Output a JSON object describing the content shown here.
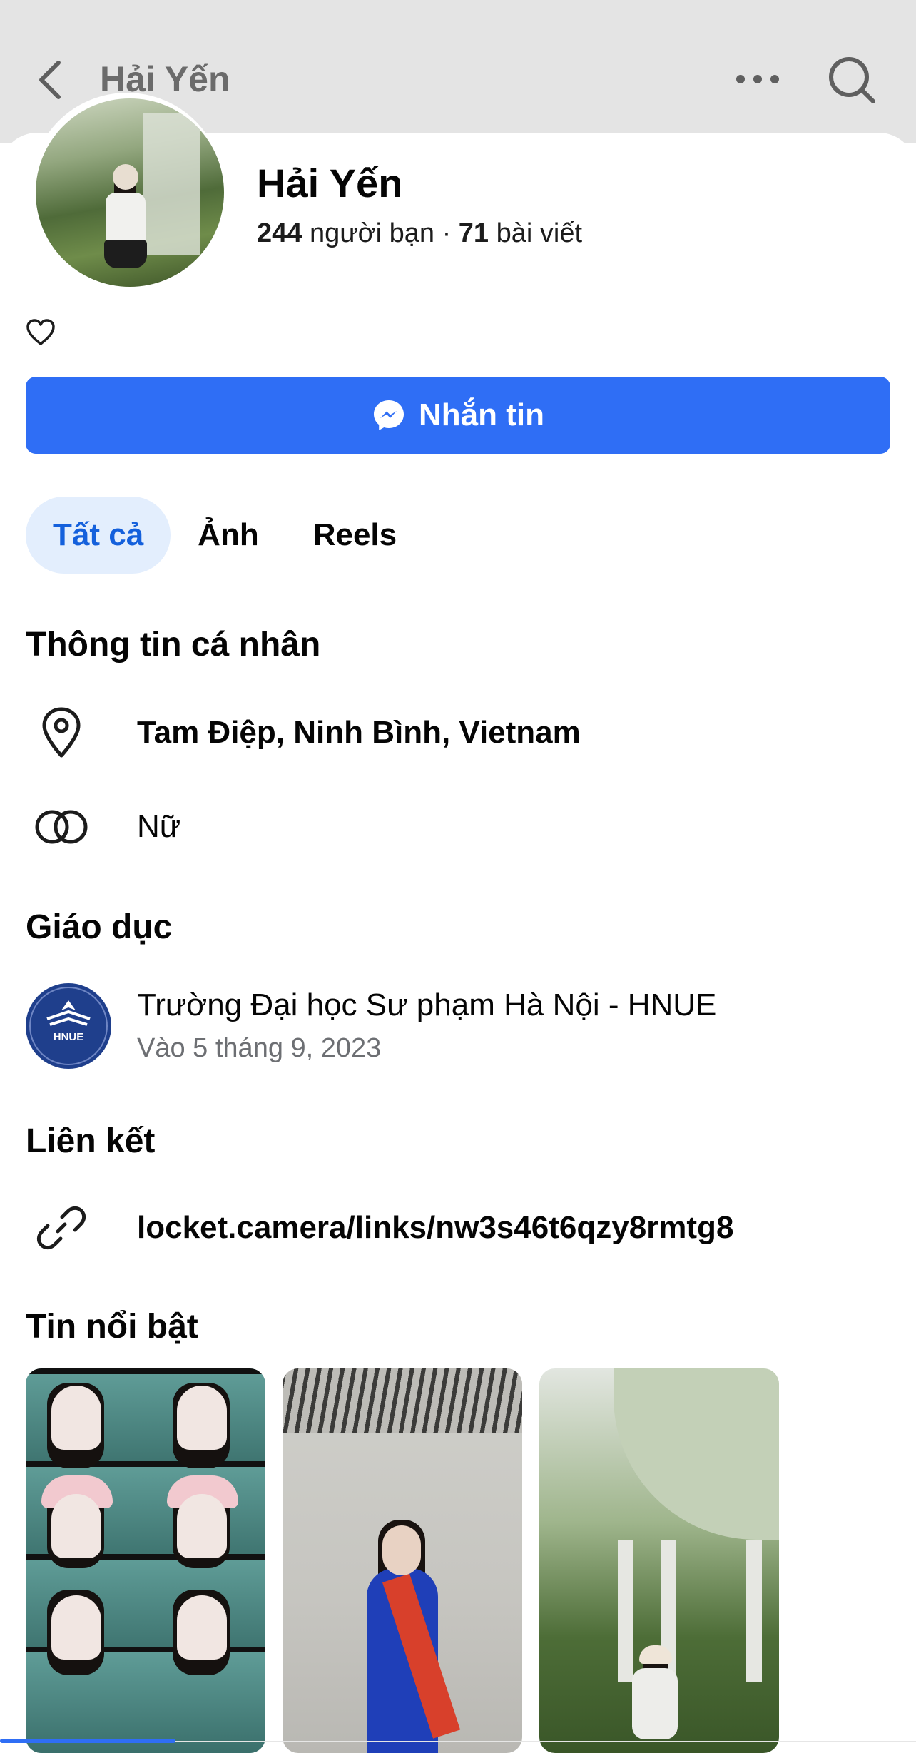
{
  "topbar": {
    "title": "Hải Yến"
  },
  "profile": {
    "name": "Hải Yến",
    "friends_count": "244",
    "friends_label": "người bạn",
    "separator": "·",
    "posts_count": "71",
    "posts_label": "bài viết"
  },
  "message_button": {
    "label": "Nhắn tin"
  },
  "tabs": [
    {
      "label": "Tất cả",
      "active": true
    },
    {
      "label": "Ảnh",
      "active": false
    },
    {
      "label": "Reels",
      "active": false
    }
  ],
  "personal_info": {
    "title": "Thông tin cá nhân",
    "location": "Tam Điệp, Ninh Bình, Vietnam",
    "gender": "Nữ"
  },
  "education": {
    "title": "Giáo dục",
    "school": "Trường Đại học Sư phạm Hà Nội - HNUE",
    "date": "Vào 5 tháng 9, 2023",
    "logo_text": "HNUE"
  },
  "links": {
    "title": "Liên kết",
    "url": "locket.camera/links/nw3s46t6qzy8rmtg8"
  },
  "highlights": {
    "title": "Tin nổi bật"
  },
  "colors": {
    "accent": "#2f6ef5",
    "tab_active_bg": "#e3eefd",
    "tab_active_text": "#1460dc",
    "secondary_text": "#6d6f73"
  }
}
